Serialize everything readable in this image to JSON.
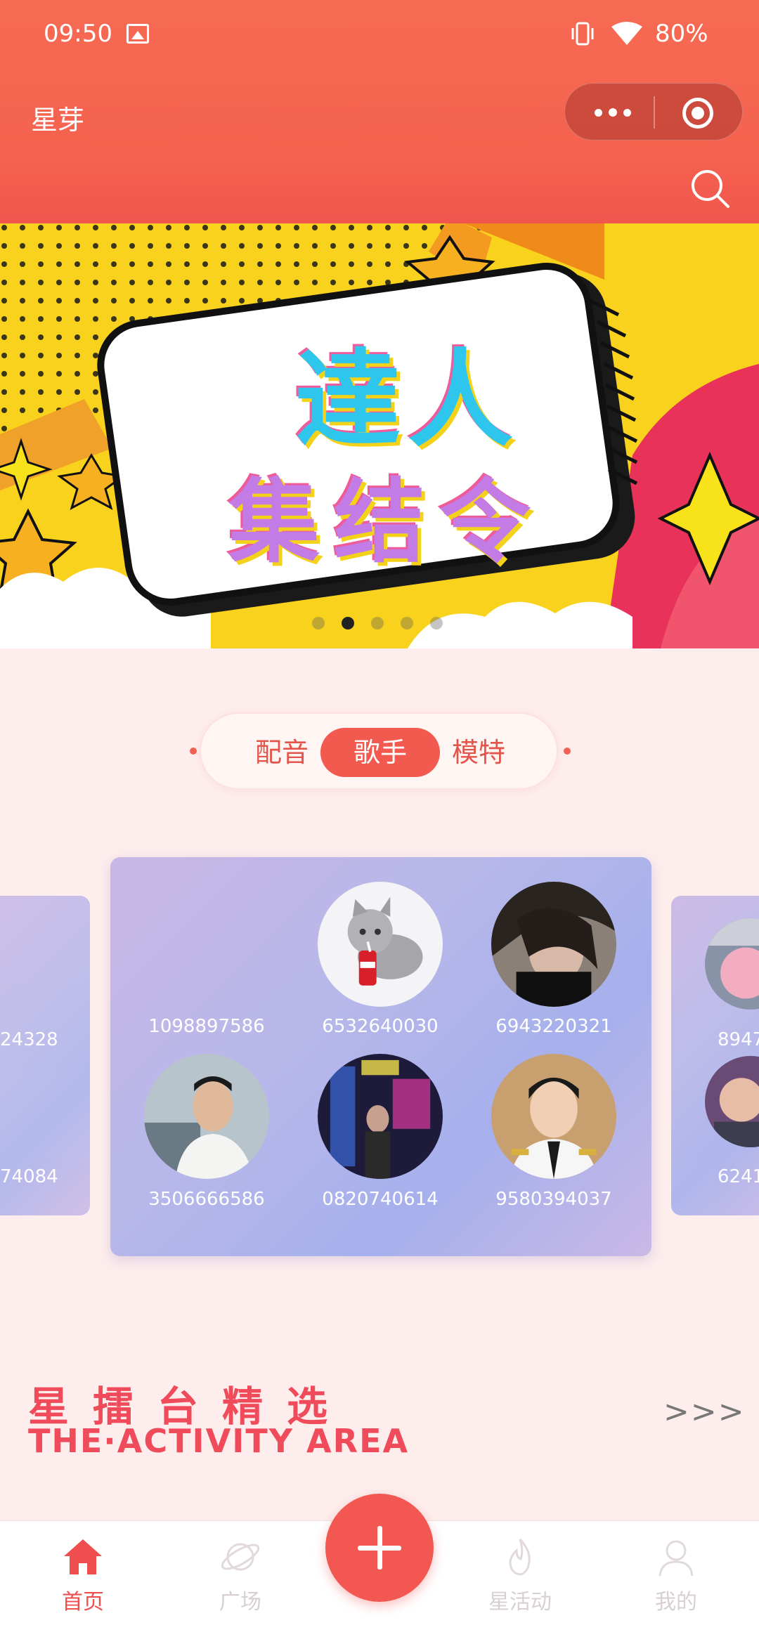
{
  "status_bar": {
    "time": "09:50",
    "battery": "80%"
  },
  "header": {
    "title": "星芽"
  },
  "banner": {
    "line1": "達人",
    "line2": "集结令",
    "slide_count": 5,
    "active_slide": 1
  },
  "tabs": [
    {
      "label": "配音",
      "active": false
    },
    {
      "label": "歌手",
      "active": true
    },
    {
      "label": "模特",
      "active": false
    }
  ],
  "performers": [
    {
      "id": "1098897586",
      "avatar": "blank"
    },
    {
      "id": "6532640030",
      "avatar": "cat-icon"
    },
    {
      "id": "6943220321",
      "avatar": "person-icon"
    },
    {
      "id": "3506666586",
      "avatar": "person-icon"
    },
    {
      "id": "0820740614",
      "avatar": "person-icon"
    },
    {
      "id": "9580394037",
      "avatar": "person-icon"
    }
  ],
  "side_cards": {
    "left": [
      "24328",
      "74084"
    ],
    "right": [
      "8947",
      "6241"
    ]
  },
  "section": {
    "title": "星擂台精选",
    "subtitle": "THE·ACTIVITY AREA",
    "more": ">>>"
  },
  "bottom_nav": [
    {
      "label": "首页",
      "icon": "home-icon",
      "active": true
    },
    {
      "label": "广场",
      "icon": "planet-icon",
      "active": false
    },
    {
      "label": "星活动",
      "icon": "flame-icon",
      "active": false
    },
    {
      "label": "我的",
      "icon": "user-icon",
      "active": false
    }
  ],
  "colors": {
    "accent": "#f35a4f",
    "header": "#f66a52",
    "background": "#fdeeed"
  }
}
